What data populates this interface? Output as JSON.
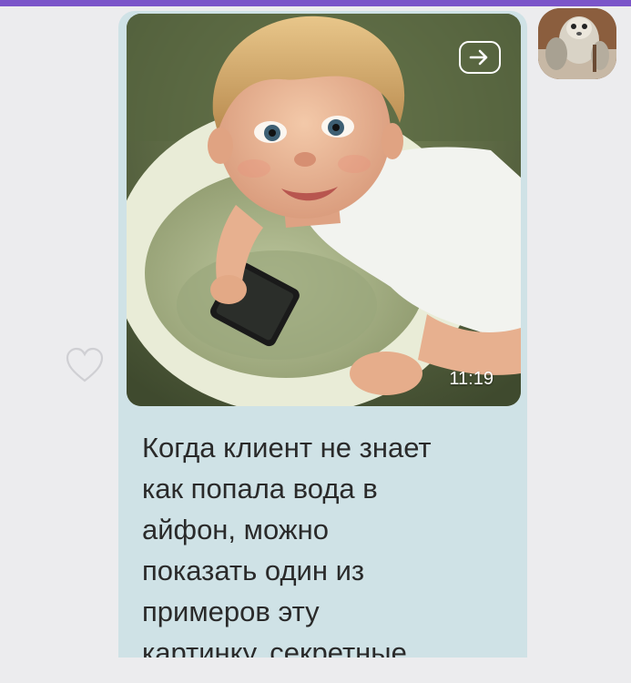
{
  "message": {
    "time": "11:19",
    "text": "Когда клиент не знает\nкак попала вода в\nайфон, можно\nпоказать один из\nпримеров эту\nкартинку, секретные",
    "bubble_color": "#cfe2e6"
  },
  "icons": {
    "share": "share-arrow-icon",
    "like": "heart-icon"
  },
  "accent_color": "#7b55c9"
}
